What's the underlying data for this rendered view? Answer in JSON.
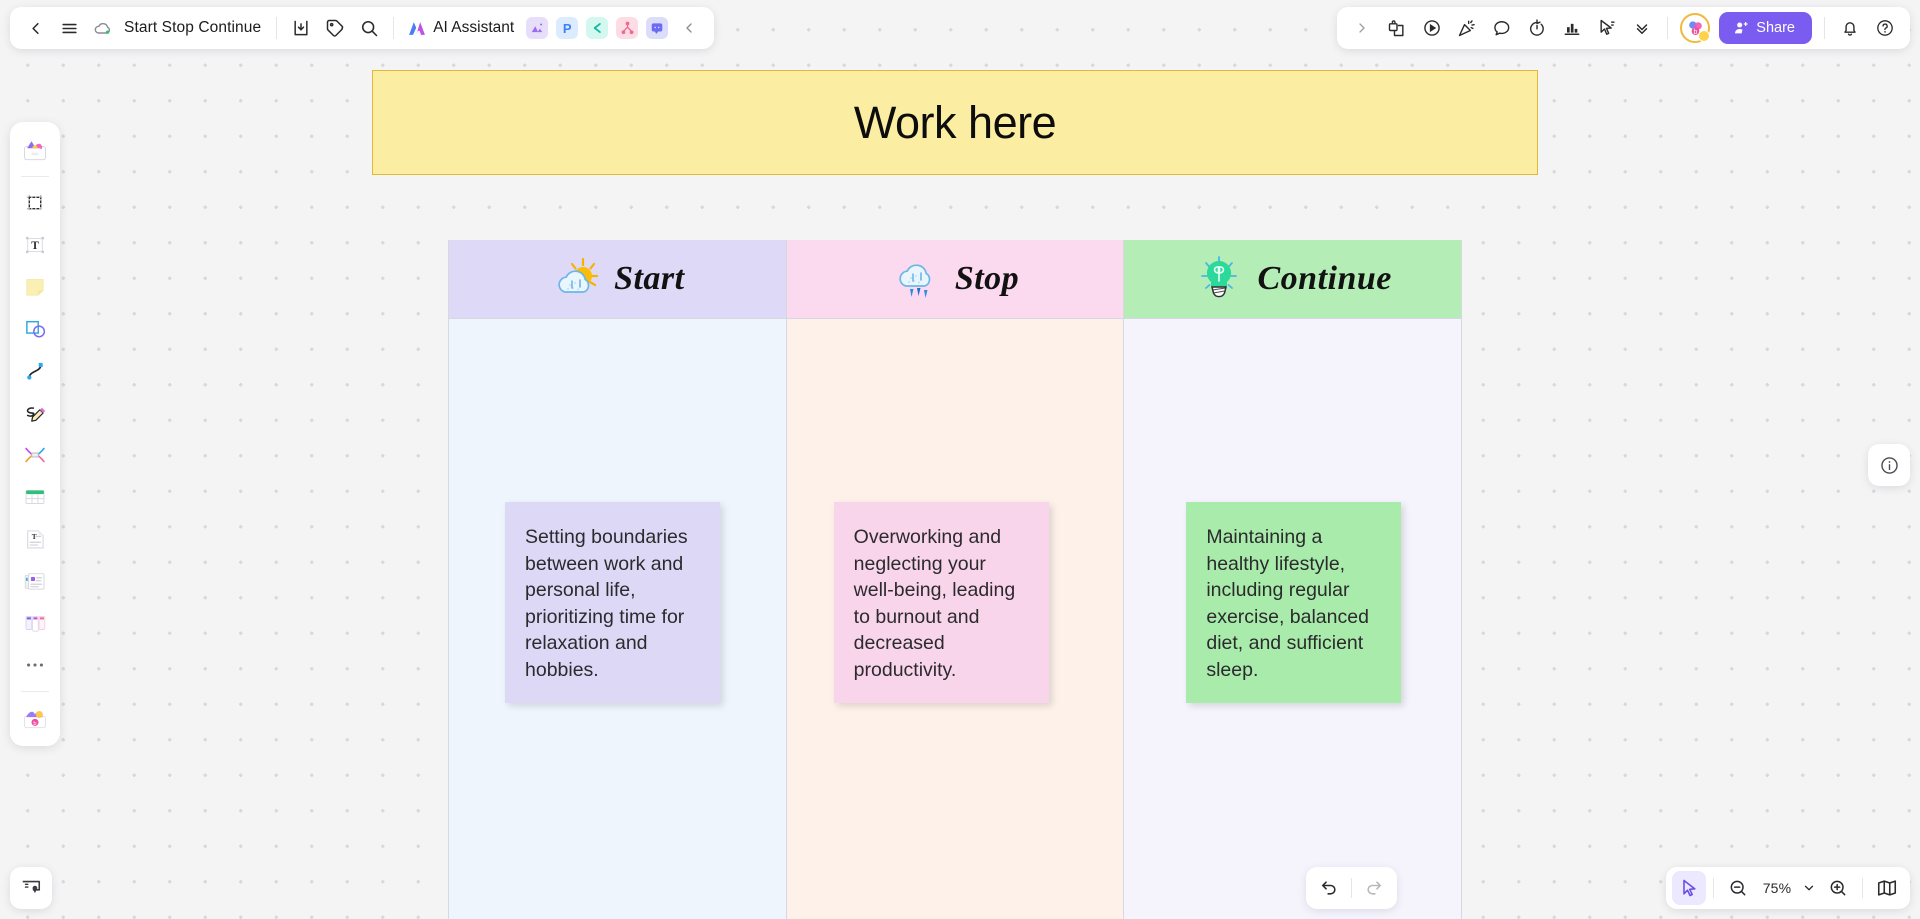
{
  "app": {
    "board_title": "Start Stop Continue",
    "zoom_level": "75%"
  },
  "toolbar_left": {
    "back_label": "back-arrow",
    "menu_label": "hamburger-menu",
    "cloud_status": "cloud-saved",
    "items": [
      {
        "name": "download-icon",
        "label": "Download"
      },
      {
        "name": "tag-icon",
        "label": "Tag"
      },
      {
        "name": "search-icon",
        "label": "Search"
      }
    ],
    "ai_assistant_label": "AI Assistant",
    "apps": [
      {
        "name": "image-app-icon",
        "label": "Image",
        "color": "#e9defc",
        "glyph": "▲"
      },
      {
        "name": "presentation-app-icon",
        "label": "P",
        "color": "#dcebfd",
        "glyph": "P"
      },
      {
        "name": "mindmap-app-icon",
        "label": "Mindmap",
        "color": "#d4f7ef",
        "glyph": "❮"
      },
      {
        "name": "flowchart-app-icon",
        "label": "Flowchart",
        "color": "#fcdde6",
        "glyph": "⑂"
      },
      {
        "name": "comment-app-icon",
        "label": "Comment",
        "color": "#dcdcfb",
        "glyph": "■"
      }
    ],
    "collapse_label": "collapse-left"
  },
  "toolbar_right": {
    "expand_label": "expand-right",
    "items": [
      {
        "name": "template-icon",
        "label": "Templates"
      },
      {
        "name": "play-icon",
        "label": "Present"
      },
      {
        "name": "celebrate-icon",
        "label": "Celebrate"
      },
      {
        "name": "comment-icon",
        "label": "Comment"
      },
      {
        "name": "timer-icon",
        "label": "Timer"
      },
      {
        "name": "vote-icon",
        "label": "Vote"
      },
      {
        "name": "cursor-share-icon",
        "label": "Cursor"
      },
      {
        "name": "chevrons-down-icon",
        "label": "More"
      }
    ],
    "brand_avatar_label": "b",
    "share_label": "Share",
    "notification_label": "Notifications",
    "help_label": "Help"
  },
  "sidebar": {
    "items": [
      {
        "name": "sidebar-item-templates",
        "label": "Templates"
      },
      {
        "name": "sidebar-item-frame",
        "label": "Frame"
      },
      {
        "name": "sidebar-item-text",
        "label": "Text"
      },
      {
        "name": "sidebar-item-sticky-note",
        "label": "Sticky note"
      },
      {
        "name": "sidebar-item-shape",
        "label": "Shape"
      },
      {
        "name": "sidebar-item-connector",
        "label": "Connector"
      },
      {
        "name": "sidebar-item-pen",
        "label": "Pen"
      },
      {
        "name": "sidebar-item-mindmap",
        "label": "Mind map"
      },
      {
        "name": "sidebar-item-table",
        "label": "Table"
      },
      {
        "name": "sidebar-item-document",
        "label": "Document"
      },
      {
        "name": "sidebar-item-card",
        "label": "Card"
      },
      {
        "name": "sidebar-item-kanban",
        "label": "Kanban"
      },
      {
        "name": "sidebar-item-more",
        "label": "More"
      },
      {
        "name": "sidebar-item-ai-gen",
        "label": "AI generate"
      }
    ]
  },
  "bottom_left": {
    "panel_label": "Presentation panel"
  },
  "right_rail": {
    "info_label": "Info"
  },
  "bottom_right": {
    "undo_label": "Undo",
    "redo_label": "Redo",
    "select_label": "Select",
    "zoom_out_label": "Zoom out",
    "zoom_in_label": "Zoom in",
    "zoom_menu_label": "Zoom options",
    "minimap_label": "Minimap"
  },
  "board": {
    "banner_text": "Work here",
    "columns": [
      {
        "key": "start",
        "title": "Start",
        "icon": "sun-behind-cloud-icon",
        "header_color": "#ddd9f7",
        "body_color": "#eef5fd",
        "note": {
          "text": "Setting boundaries between work and personal life, prioritizing time for relaxation and hobbies.",
          "color": "#dcd8f5"
        }
      },
      {
        "key": "stop",
        "title": "Stop",
        "icon": "rain-cloud-icon",
        "header_color": "#fbd9ee",
        "body_color": "#fdf1ea",
        "note": {
          "text": "Overworking and neglecting your well-being, leading to burnout and decreased productivity.",
          "color": "#f9d5ec"
        }
      },
      {
        "key": "continue",
        "title": "Continue",
        "icon": "lightbulb-icon",
        "header_color": "#b4edb6",
        "body_color": "#f5f4fd",
        "note": {
          "text": "Maintaining a healthy lifestyle, including regular exercise, balanced diet, and sufficient sleep.",
          "color": "#a9ebaa"
        }
      }
    ]
  }
}
